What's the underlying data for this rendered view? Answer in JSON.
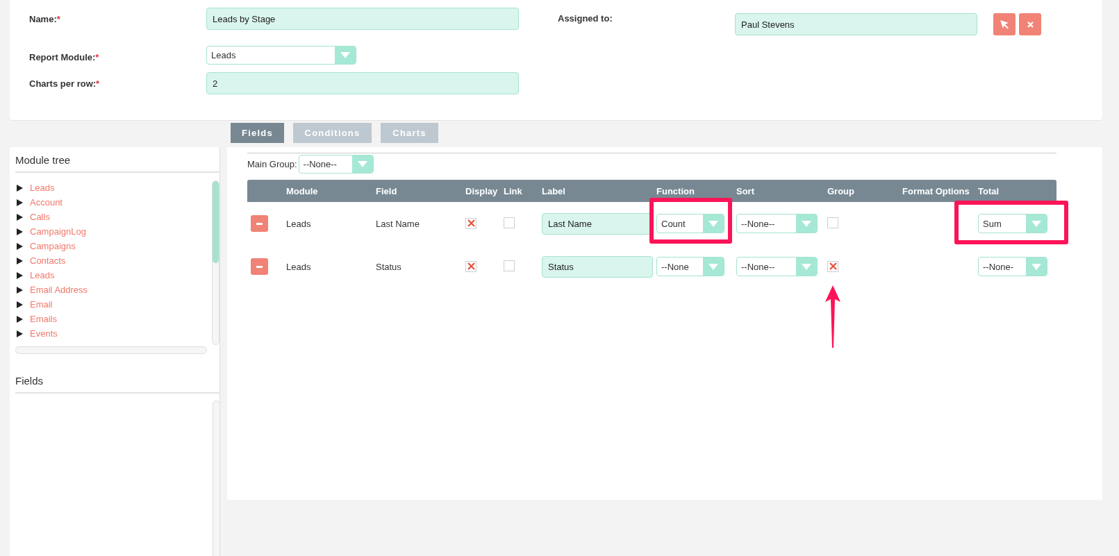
{
  "form": {
    "fields": [
      {
        "label": "Name:",
        "required_mark": "*",
        "kind": "text",
        "value": "Leads by Stage"
      },
      {
        "label": "Report Module:",
        "required_mark": "*",
        "kind": "select",
        "value": "Leads"
      },
      {
        "label": "Charts per row:",
        "required_mark": "*",
        "kind": "text",
        "value": "2"
      }
    ],
    "assigned_to": {
      "label": "Assigned to:",
      "value": "Paul Stevens"
    }
  },
  "tabs": [
    {
      "label": "Fields",
      "selected": true
    },
    {
      "label": "Conditions",
      "selected": false
    },
    {
      "label": "Charts",
      "selected": false
    }
  ],
  "module_tree": {
    "title": "Module tree",
    "items": [
      "Leads",
      "Account",
      "Calls",
      "CampaignLog",
      "Campaigns",
      "Contacts",
      "Leads",
      "Email Address",
      "Email",
      "Emails",
      "Events"
    ]
  },
  "fields_panel": {
    "title": "Fields"
  },
  "main_group": {
    "label": "Main Group:",
    "value": "--None--"
  },
  "table": {
    "columns": [
      "Module",
      "Field",
      "Display",
      "Link",
      "Label",
      "Function",
      "Sort",
      "Group",
      "Format Options",
      "Total"
    ],
    "rows": [
      {
        "module": "Leads",
        "field": "Last Name",
        "display": true,
        "link": false,
        "label": "Last Name",
        "function": "Count",
        "sort": "--None--",
        "group": false,
        "total": "Sum"
      },
      {
        "module": "Leads",
        "field": "Status",
        "display": true,
        "link": false,
        "label": "Status",
        "function": "--None",
        "sort": "--None--",
        "group": true,
        "total": "--None-"
      }
    ]
  }
}
